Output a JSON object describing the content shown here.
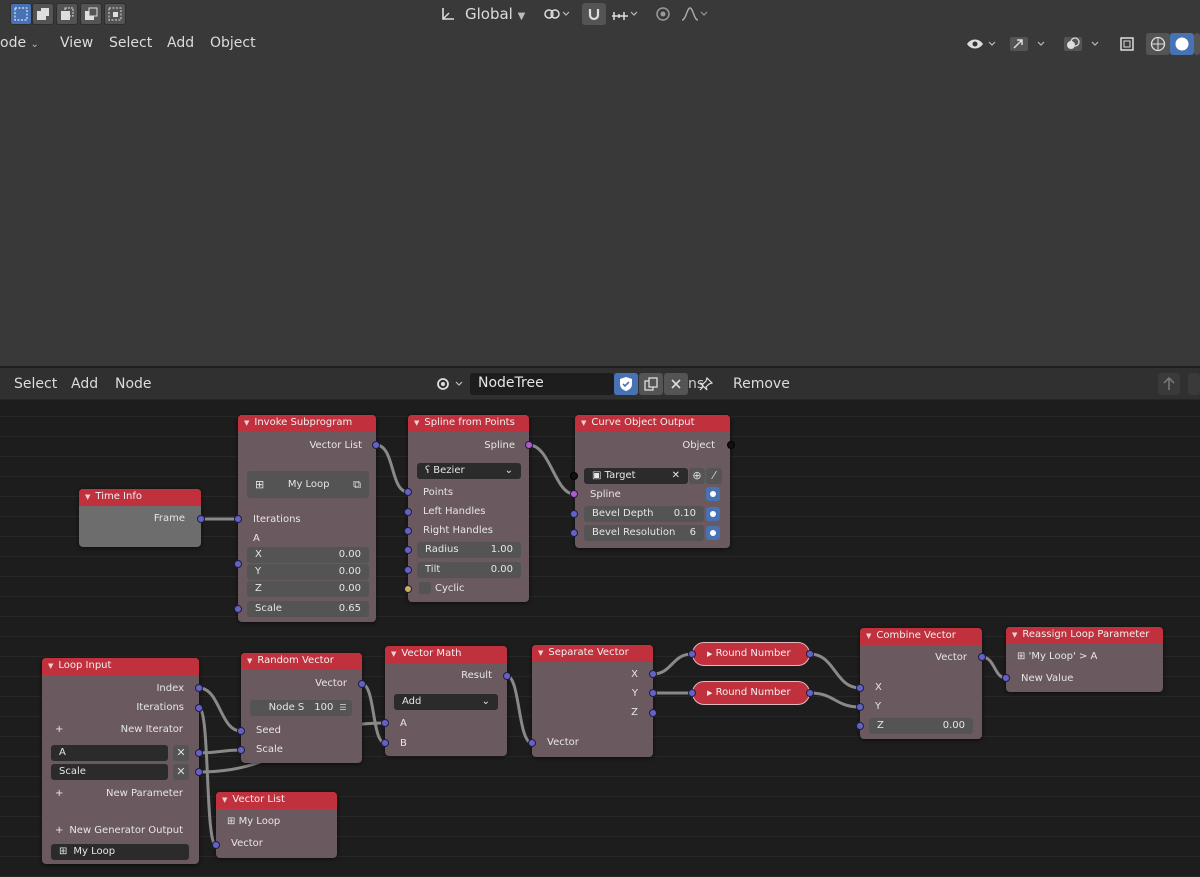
{
  "viewport": {
    "orientation_label": "Global",
    "header_menu": {
      "mode_partial": "ode",
      "view": "View",
      "select": "Select",
      "add": "Add",
      "object": "Object"
    }
  },
  "node_editor": {
    "menu": {
      "select": "Select",
      "add": "Add",
      "node": "Node"
    },
    "tree_name": "NodeTree",
    "partial_label": "ns",
    "remove_label": "Remove"
  },
  "nodes": {
    "invoke_subprogram": {
      "title": "Invoke Subprogram",
      "out_vector_list": "Vector List",
      "subprogram": "My Loop",
      "iterations": "Iterations",
      "a": "A",
      "x_label": "X",
      "x_value": "0.00",
      "y_label": "Y",
      "y_value": "0.00",
      "z_label": "Z",
      "z_value": "0.00",
      "scale_label": "Scale",
      "scale_value": "0.65"
    },
    "time_info": {
      "title": "Time Info",
      "frame": "Frame"
    },
    "spline_from_points": {
      "title": "Spline from Points",
      "out_spline": "Spline",
      "type": "Bezier",
      "points": "Points",
      "left_handles": "Left Handles",
      "right_handles": "Right Handles",
      "radius_label": "Radius",
      "radius_value": "1.00",
      "tilt_label": "Tilt",
      "tilt_value": "0.00",
      "cyclic": "Cyclic"
    },
    "curve_object_output": {
      "title": "Curve Object Output",
      "out_object": "Object",
      "target": "Target",
      "spline": "Spline",
      "bevel_depth_label": "Bevel Depth",
      "bevel_depth_value": "0.10",
      "bevel_resolution_label": "Bevel Resolution",
      "bevel_resolution_value": "6"
    },
    "loop_input": {
      "title": "Loop Input",
      "index": "Index",
      "iterations": "Iterations",
      "new_iterator": "New Iterator",
      "param_a": "A",
      "param_scale": "Scale",
      "new_parameter": "New Parameter",
      "new_generator_output": "New Generator Output",
      "generator": "My Loop"
    },
    "random_vector": {
      "title": "Random Vector",
      "out_vector": "Vector",
      "node_seed_label": "Node S",
      "node_seed_value": "100",
      "seed": "Seed",
      "scale": "Scale"
    },
    "vector_math": {
      "title": "Vector Math",
      "out_result": "Result",
      "operation": "Add",
      "a": "A",
      "b": "B"
    },
    "separate_vector": {
      "title": "Separate Vector",
      "x": "X",
      "y": "Y",
      "z": "Z",
      "in_vector": "Vector"
    },
    "round_number_1": {
      "title": "Round Number"
    },
    "round_number_2": {
      "title": "Round Number"
    },
    "combine_vector": {
      "title": "Combine Vector",
      "out_vector": "Vector",
      "x": "X",
      "y": "Y",
      "z_label": "Z",
      "z_value": "0.00"
    },
    "reassign_loop_parameter": {
      "title": "Reassign Loop Parameter",
      "target": "'My Loop' > A",
      "new_value": "New Value"
    },
    "vector_list": {
      "title": "Vector List",
      "loop": "My Loop",
      "vector": "Vector"
    }
  },
  "colors": {
    "node_header": "#c0313d",
    "socket_vector": "#6462c8",
    "socket_spline": "#b05ad0",
    "accent": "#4772b3"
  }
}
